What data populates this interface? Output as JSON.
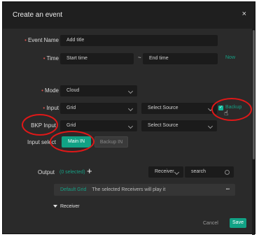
{
  "dialog": {
    "title": "Create an event",
    "close_glyph": "×",
    "required_mark": "•"
  },
  "event_name": {
    "label": "Event Name",
    "placeholder": "Add title"
  },
  "time": {
    "label": "Time",
    "start_placeholder": "Start time",
    "separator": "~",
    "end_placeholder": "End time",
    "now_link": "Now"
  },
  "mode": {
    "label": "Mode",
    "value": "Cloud"
  },
  "input": {
    "label": "Input",
    "value": "Grid",
    "source_placeholder": "Select Source",
    "backup_label": "Backup",
    "backup_checked": true
  },
  "bkp_input": {
    "label": "BKP Input",
    "value": "Grid",
    "source_placeholder": "Select Source"
  },
  "input_select": {
    "label": "Input select",
    "main_label": "Main IN",
    "backup_label": "Backup IN",
    "active": "Main IN"
  },
  "output": {
    "label": "Output",
    "selected_count": "(0 selected)",
    "add_glyph": "+",
    "filter_value": "Receiver",
    "search_placeholder": "search",
    "grid_name": "Default Grid",
    "grid_message": "The selected Receivers will play it",
    "more_glyph": "•••",
    "receiver_toggle": "Receiver"
  },
  "footer": {
    "cancel_label": "Cancel",
    "save_label": "Save"
  },
  "colors": {
    "accent": "#11a285",
    "annotation": "#e01818",
    "required": "#d9534f",
    "background": "#2a2a2a"
  }
}
